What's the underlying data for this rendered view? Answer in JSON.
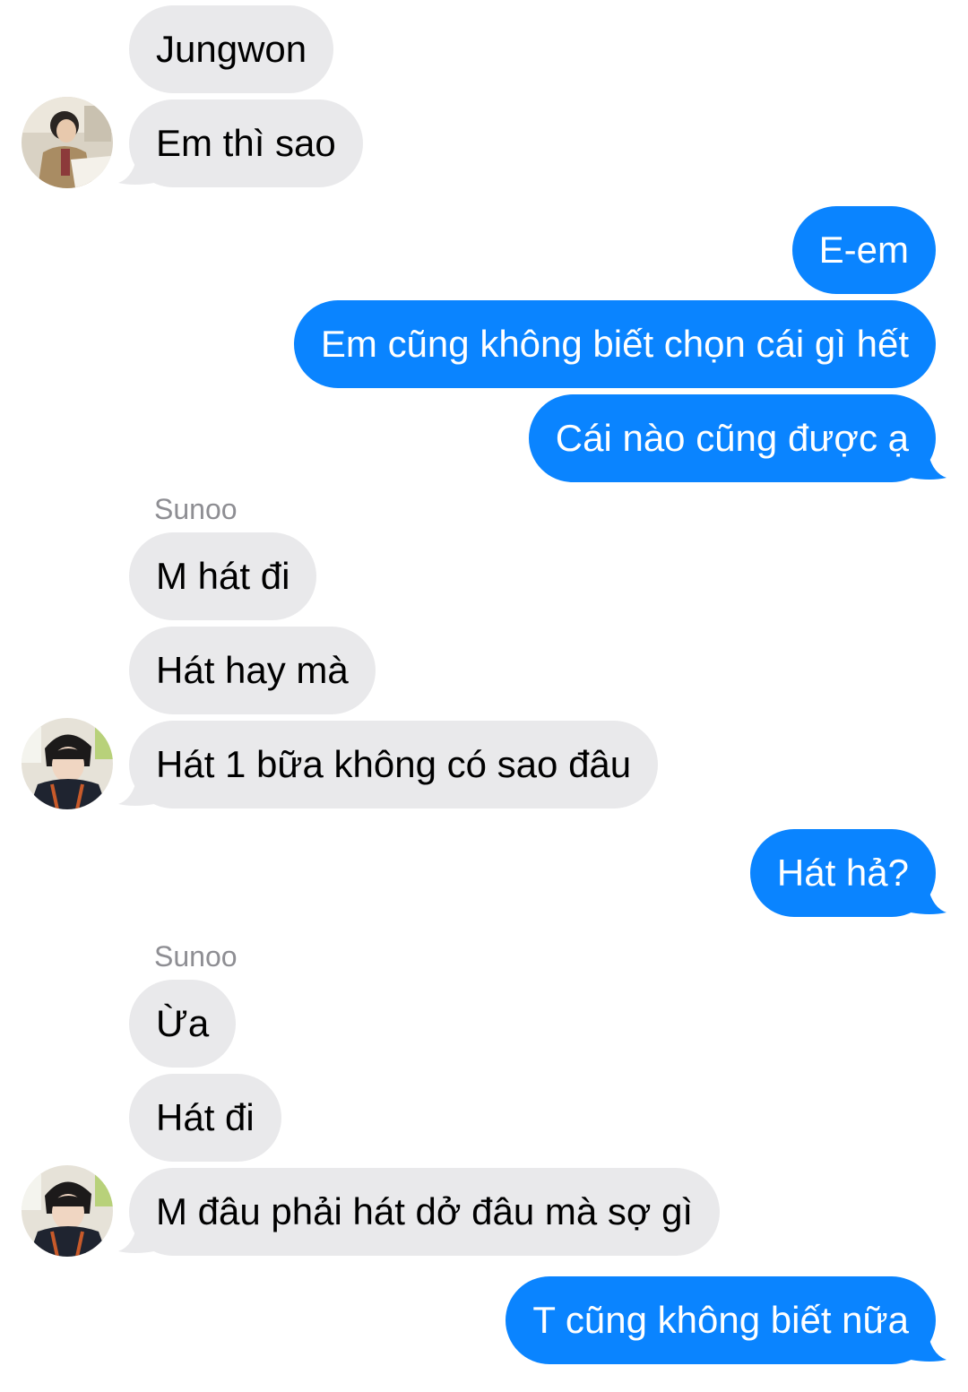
{
  "colors": {
    "incoming_bubble": "#e9e9eb",
    "outgoing_bubble": "#0a84ff",
    "sender_label": "#8e8e93"
  },
  "messages": [
    {
      "id": 1,
      "from": "Jungwon",
      "direction": "incoming",
      "text": "Jungwon"
    },
    {
      "id": 2,
      "from": "Jungwon",
      "direction": "incoming",
      "text": "Em thì sao",
      "avatar": "jungwon-avatar"
    },
    {
      "id": 3,
      "direction": "outgoing",
      "text": "E-em"
    },
    {
      "id": 4,
      "direction": "outgoing",
      "text": "Em cũng không biết chọn cái gì hết"
    },
    {
      "id": 5,
      "direction": "outgoing",
      "text": "Cái nào cũng được ạ"
    },
    {
      "id": 6,
      "sender_label": "Sunoo"
    },
    {
      "id": 7,
      "from": "Sunoo",
      "direction": "incoming",
      "text": "M hát đi"
    },
    {
      "id": 8,
      "from": "Sunoo",
      "direction": "incoming",
      "text": "Hát hay mà"
    },
    {
      "id": 9,
      "from": "Sunoo",
      "direction": "incoming",
      "text": "Hát 1 bữa không có sao đâu",
      "avatar": "sunoo-avatar"
    },
    {
      "id": 10,
      "direction": "outgoing",
      "text": "Hát hả?"
    },
    {
      "id": 11,
      "sender_label": "Sunoo"
    },
    {
      "id": 12,
      "from": "Sunoo",
      "direction": "incoming",
      "text": "Ừa"
    },
    {
      "id": 13,
      "from": "Sunoo",
      "direction": "incoming",
      "text": "Hát đi"
    },
    {
      "id": 14,
      "from": "Sunoo",
      "direction": "incoming",
      "text": "M đâu phải hát dở đâu mà sợ gì",
      "avatar": "sunoo-avatar"
    },
    {
      "id": 15,
      "direction": "outgoing",
      "text": "T cũng không biết nữa"
    }
  ]
}
